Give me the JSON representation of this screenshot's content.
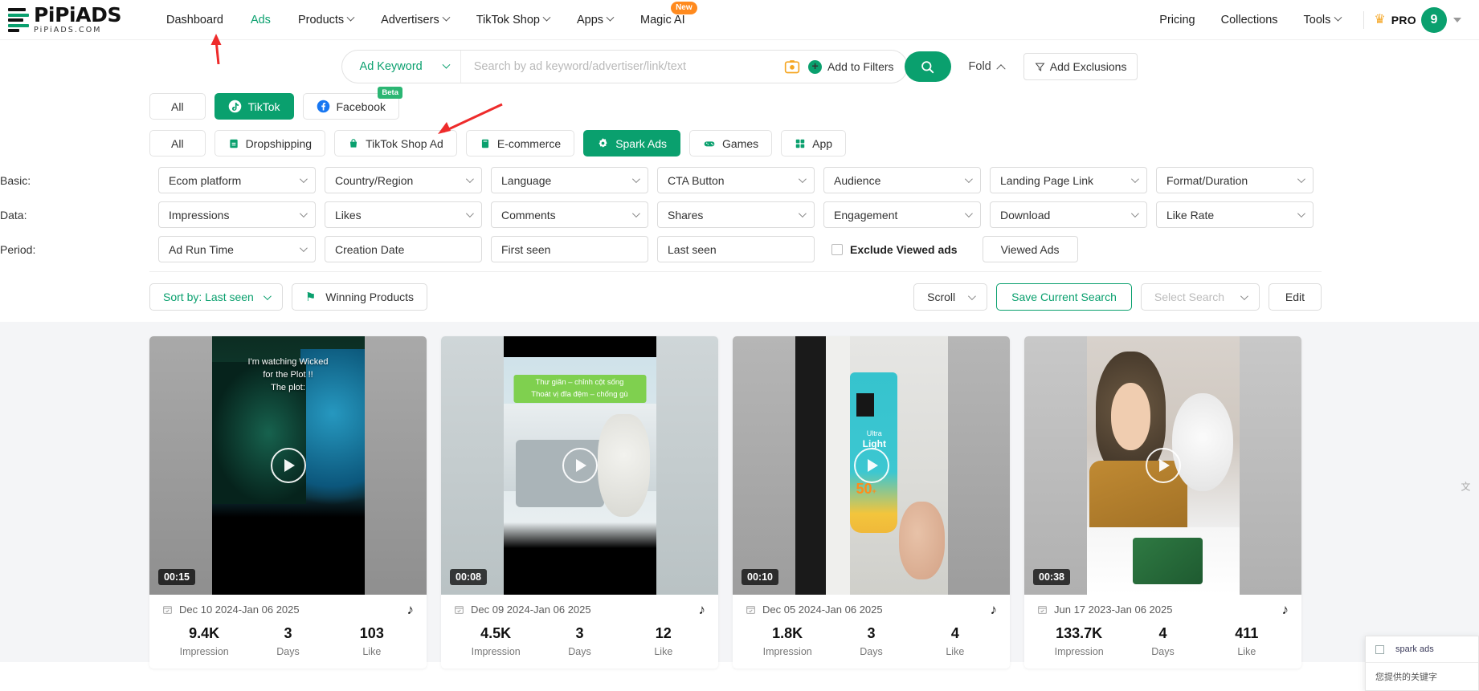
{
  "brand": {
    "name": "PiPiADS",
    "domain": "PiPiADS.COM"
  },
  "nav": {
    "items": [
      {
        "label": "Dashboard",
        "has_caret": false,
        "active": false
      },
      {
        "label": "Ads",
        "has_caret": false,
        "active": true
      },
      {
        "label": "Products",
        "has_caret": true,
        "active": false
      },
      {
        "label": "Advertisers",
        "has_caret": true,
        "active": false
      },
      {
        "label": "TikTok Shop",
        "has_caret": true,
        "active": false
      },
      {
        "label": "Apps",
        "has_caret": true,
        "active": false
      },
      {
        "label": "Magic AI",
        "has_caret": false,
        "active": false,
        "badge": "New"
      }
    ],
    "right": [
      {
        "label": "Pricing",
        "has_caret": false
      },
      {
        "label": "Collections",
        "has_caret": false
      },
      {
        "label": "Tools",
        "has_caret": true
      }
    ],
    "pro_label": "PRO",
    "avatar_initial": "9",
    "crown_icon": "crown-icon"
  },
  "search": {
    "type_label": "Ad Keyword",
    "placeholder": "Search by ad keyword/advertiser/link/text",
    "value": "",
    "camera_icon": "image-search-icon",
    "add_to_filters": "Add to Filters",
    "search_icon": "search-icon",
    "fold_label": "Fold",
    "add_exclusions": "Add Exclusions",
    "exclusions_icon": "filter-funnel-icon"
  },
  "platform_tabs": [
    {
      "label": "All",
      "icon": null,
      "active": false
    },
    {
      "label": "TikTok",
      "icon": "tiktok-icon",
      "active": true
    },
    {
      "label": "Facebook",
      "icon": "facebook-icon",
      "active": false,
      "badge": "Beta"
    }
  ],
  "category_tabs": [
    {
      "label": "All",
      "icon": null,
      "active": false
    },
    {
      "label": "Dropshipping",
      "icon": "dropship-box-icon",
      "active": false
    },
    {
      "label": "TikTok Shop Ad",
      "icon": "shop-bag-icon",
      "active": false
    },
    {
      "label": "E-commerce",
      "icon": "ecommerce-icon",
      "active": false
    },
    {
      "label": "Spark Ads",
      "icon": "spark-gear-icon",
      "active": true
    },
    {
      "label": "Games",
      "icon": "gamepad-icon",
      "active": false
    },
    {
      "label": "App",
      "icon": "grid-apps-icon",
      "active": false
    }
  ],
  "filter_rows": [
    {
      "label": "Basic:",
      "fields": [
        {
          "label": "Ecom platform",
          "chevron": true
        },
        {
          "label": "Country/Region",
          "chevron": true
        },
        {
          "label": "Language",
          "chevron": true
        },
        {
          "label": "CTA Button",
          "chevron": true
        },
        {
          "label": "Audience",
          "chevron": true
        },
        {
          "label": "Landing Page Link",
          "chevron": true
        },
        {
          "label": "Format/Duration",
          "chevron": true
        }
      ]
    },
    {
      "label": "Data:",
      "fields": [
        {
          "label": "Impressions",
          "chevron": true
        },
        {
          "label": "Likes",
          "chevron": true
        },
        {
          "label": "Comments",
          "chevron": true
        },
        {
          "label": "Shares",
          "chevron": true
        },
        {
          "label": "Engagement",
          "chevron": true
        },
        {
          "label": "Download",
          "chevron": true
        },
        {
          "label": "Like Rate",
          "chevron": true
        }
      ]
    },
    {
      "label": "Period:",
      "fields": [
        {
          "label": "Ad Run Time",
          "chevron": true
        },
        {
          "label": "Creation Date",
          "chevron": false
        },
        {
          "label": "First seen",
          "chevron": false
        },
        {
          "label": "Last seen",
          "chevron": false
        }
      ],
      "checkbox": {
        "label": "Exclude Viewed ads",
        "checked": false
      },
      "button": {
        "label": "Viewed Ads"
      }
    }
  ],
  "toolbar": {
    "sort_label": "Sort by: Last seen",
    "winning_products": "Winning Products",
    "winning_icon": "flag-icon",
    "scroll_label": "Scroll",
    "save_search": "Save Current Search",
    "select_search": "Select Search",
    "edit": "Edit"
  },
  "cards": [
    {
      "duration": "00:15",
      "overlay_text": "I'm watching Wicked\nfor the Plot !!\nThe plot:",
      "date_range": "Dec 10 2024-Jan 06 2025",
      "source_icon": "tiktok-note-icon",
      "stats": [
        {
          "value": "9.4K",
          "label": "Impression"
        },
        {
          "value": "3",
          "label": "Days"
        },
        {
          "value": "103",
          "label": "Like"
        }
      ]
    },
    {
      "duration": "00:08",
      "overlay_text": "Thư giãn – chỉnh cột sống\nThoát vị đĩa đệm – chống gù",
      "date_range": "Dec 09 2024-Jan 06 2025",
      "source_icon": "tiktok-note-icon",
      "stats": [
        {
          "value": "4.5K",
          "label": "Impression"
        },
        {
          "value": "3",
          "label": "Days"
        },
        {
          "value": "12",
          "label": "Like"
        }
      ]
    },
    {
      "duration": "00:10",
      "overlay_text": "",
      "date_range": "Dec 05 2024-Jan 06 2025",
      "source_icon": "tiktok-note-icon",
      "stats": [
        {
          "value": "1.8K",
          "label": "Impression"
        },
        {
          "value": "3",
          "label": "Days"
        },
        {
          "value": "4",
          "label": "Like"
        }
      ]
    },
    {
      "duration": "00:38",
      "overlay_text": "",
      "date_range": "Jun 17 2023-Jan 06 2025",
      "source_icon": "tiktok-note-icon",
      "stats": [
        {
          "value": "133.7K",
          "label": "Impression"
        },
        {
          "value": "4",
          "label": "Days"
        },
        {
          "value": "411",
          "label": "Like"
        }
      ]
    }
  ],
  "side_widget": {
    "item_label": "spark ads",
    "footer_text": "您提供的关键字"
  },
  "colors": {
    "brand_green": "#0aa06e",
    "accent_orange": "#ff8a1e",
    "beta_green": "#2bb673",
    "arrow_red": "#ee2b2b",
    "results_bg": "#f4f5f7"
  }
}
